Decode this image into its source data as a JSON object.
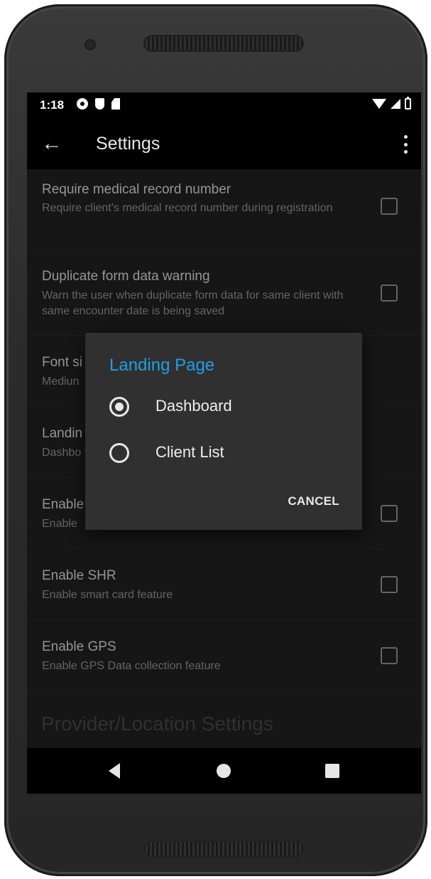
{
  "status_bar": {
    "time": "1:18",
    "left_icons": [
      "gear-icon",
      "shield-icon",
      "sd-card-icon"
    ],
    "right_icons": [
      "wifi-icon",
      "signal-icon",
      "battery-icon"
    ]
  },
  "app_bar": {
    "title": "Settings",
    "back_icon": "arrow-left-icon",
    "menu_icon": "overflow-menu-icon"
  },
  "preferences": [
    {
      "title": "Require medical record number",
      "summary": "Require client's medical record number during registration",
      "checkbox": true,
      "checked": false
    },
    {
      "title": "Duplicate form data warning",
      "summary": "Warn the user when duplicate form data for same client with same encounter date is being saved",
      "checkbox": true,
      "checked": false
    },
    {
      "title": "Font si",
      "summary": "Mediun",
      "checkbox": false
    },
    {
      "title": "Landin",
      "summary": "Dashbo",
      "checkbox": false
    },
    {
      "title": "Enable",
      "summary": "Enable",
      "checkbox": true,
      "checked": false
    },
    {
      "title": "Enable SHR",
      "summary": "Enable smart card feature",
      "checkbox": true,
      "checked": false
    },
    {
      "title": "Enable GPS",
      "summary": "Enable GPS Data collection feature",
      "checkbox": true,
      "checked": false
    }
  ],
  "section_header": "Provider/Location Settings",
  "dialog": {
    "title": "Landing Page",
    "options": [
      {
        "label": "Dashboard",
        "selected": true
      },
      {
        "label": "Client List",
        "selected": false
      }
    ],
    "cancel_label": "CANCEL"
  },
  "nav_bar": {
    "icons": [
      "back-triangle-icon",
      "home-circle-icon",
      "recents-square-icon"
    ]
  },
  "colors": {
    "accent": "#1e9fe6",
    "background": "#222222",
    "dialog": "#303030"
  }
}
